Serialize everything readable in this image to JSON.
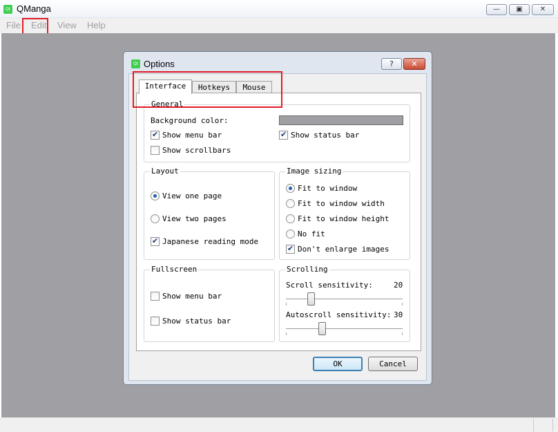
{
  "window": {
    "title": "QManga",
    "icon": "qt-app-icon",
    "controls": [
      "minimize",
      "maximize",
      "close"
    ]
  },
  "menubar": {
    "items": [
      "File",
      "Edit",
      "View",
      "Help"
    ]
  },
  "dialog": {
    "title": "Options",
    "help_label": "?",
    "tabs": [
      "Interface",
      "Hotkeys",
      "Mouse"
    ],
    "active_tab": "Interface",
    "general": {
      "title": "General",
      "bg_color_label": "Background color:",
      "bg_color_value": "#a0a0a4",
      "show_menu_bar": {
        "label": "Show menu bar",
        "checked": true
      },
      "show_status_bar": {
        "label": "Show status bar",
        "checked": true
      },
      "show_scrollbars": {
        "label": "Show scrollbars",
        "checked": false
      }
    },
    "layout": {
      "title": "Layout",
      "view_one_page": {
        "label": "View one page",
        "selected": true
      },
      "view_two_pages": {
        "label": "View two pages",
        "selected": false
      },
      "japanese_mode": {
        "label": "Japanese reading mode",
        "checked": true
      }
    },
    "image_sizing": {
      "title": "Image sizing",
      "fit_to_window": {
        "label": "Fit to window",
        "selected": true
      },
      "fit_width": {
        "label": "Fit to window width",
        "selected": false
      },
      "fit_height": {
        "label": "Fit to window height",
        "selected": false
      },
      "no_fit": {
        "label": "No fit",
        "selected": false
      },
      "dont_enlarge": {
        "label": "Don't enlarge images",
        "checked": true
      }
    },
    "fullscreen": {
      "title": "Fullscreen",
      "show_menu_bar": {
        "label": "Show menu bar",
        "checked": false
      },
      "show_status_bar": {
        "label": "Show status bar",
        "checked": false
      }
    },
    "scrolling": {
      "title": "Scrolling",
      "scroll_label": "Scroll sensitivity:",
      "scroll_value": "20",
      "autoscroll_label": "Autoscroll sensitivity:",
      "autoscroll_value": "30"
    },
    "ok_label": "OK",
    "cancel_label": "Cancel"
  },
  "colors": {
    "accent_highlight": "#e01b24",
    "workspace": "#a0a0a4"
  }
}
